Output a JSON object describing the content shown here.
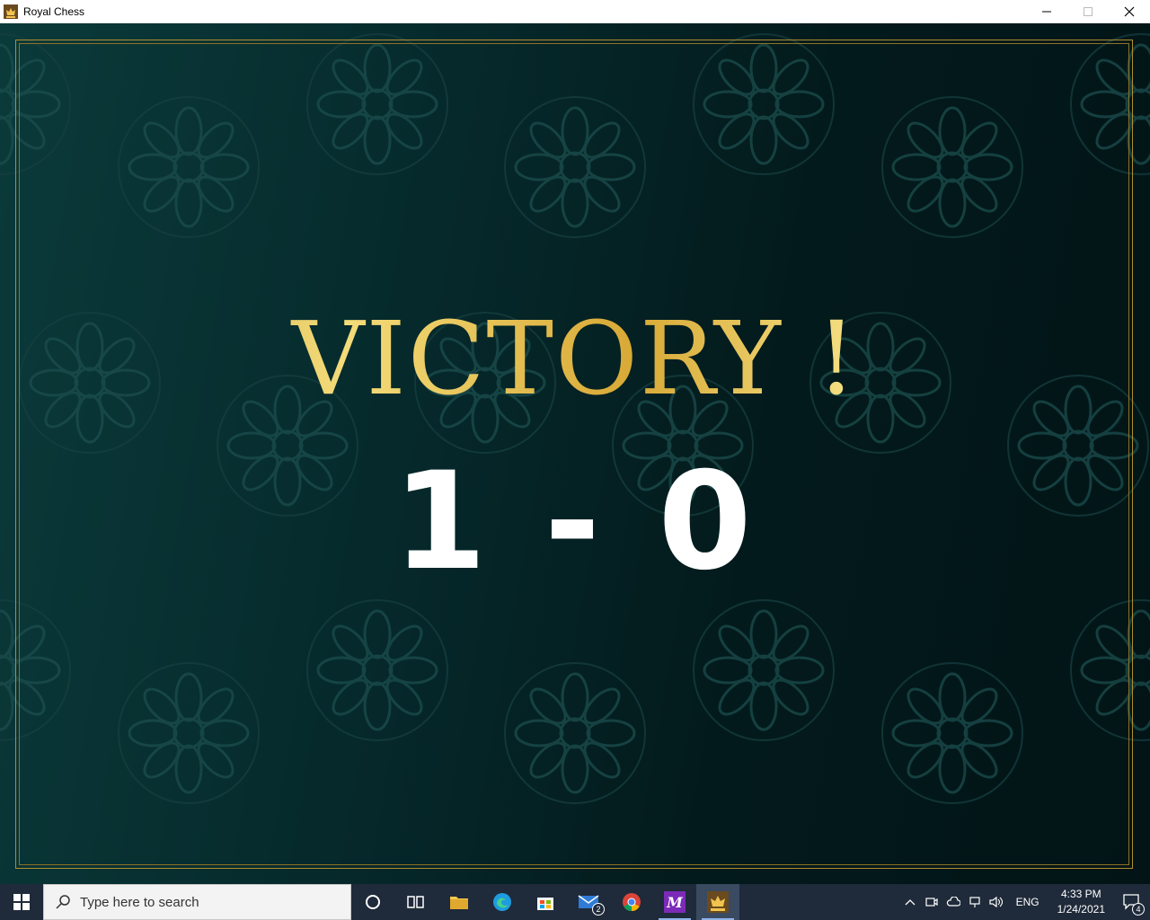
{
  "window": {
    "title": "Royal Chess",
    "app_icon": "chess-king-icon",
    "controls": [
      "minimize-icon",
      "maximize-icon",
      "close-icon"
    ]
  },
  "game": {
    "headline": "VICTORY !",
    "score": "1 - 0",
    "colors": {
      "gold": "#d8a935",
      "background": "#062a2c",
      "score_text": "#ffffff"
    }
  },
  "taskbar": {
    "search_placeholder": "Type here to search",
    "pinned": [
      {
        "name": "cortana",
        "icon": "circle-icon"
      },
      {
        "name": "task-view",
        "icon": "task-view-icon"
      },
      {
        "name": "file-explorer",
        "icon": "folder-icon"
      },
      {
        "name": "edge",
        "icon": "edge-icon"
      },
      {
        "name": "store",
        "icon": "store-icon"
      },
      {
        "name": "mail",
        "icon": "mail-icon",
        "badge": "2"
      },
      {
        "name": "chrome",
        "icon": "chrome-icon"
      },
      {
        "name": "app-m",
        "icon": "m-app-icon"
      },
      {
        "name": "royal-chess",
        "icon": "chess-king-icon",
        "active": true
      }
    ],
    "tray": {
      "language": "ENG",
      "time": "4:33 PM",
      "date": "1/24/2021",
      "notification_count": "4"
    }
  }
}
